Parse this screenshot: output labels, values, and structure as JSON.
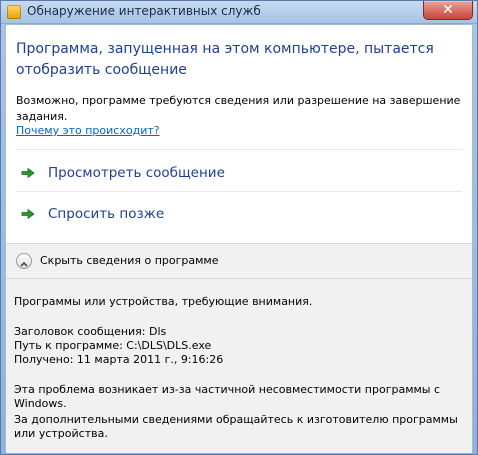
{
  "window": {
    "title": "Обнаружение интерактивных служб",
    "close_glyph": "✕"
  },
  "main": {
    "heading": "Программа, запущенная на этом компьютере, пытается отобразить сообщение",
    "description": "Возможно, программе требуются сведения или разрешение на завершение задания.",
    "why_link": "Почему это происходит?",
    "commands": [
      {
        "label": "Просмотреть сообщение",
        "icon": "green-arrow-icon"
      },
      {
        "label": "Спросить позже",
        "icon": "green-arrow-icon"
      }
    ]
  },
  "details_toggle": {
    "label": "Скрыть сведения о программе",
    "icon": "chevron-up-icon"
  },
  "details": {
    "intro": "Программы или устройства, требующие внимания.",
    "message_title": "Заголовок сообщения:  Dls",
    "program_path": "Путь к программе:  C:\\DLS\\DLS.exe",
    "received": "Получено:  11 марта 2011 г., 9:16:26",
    "problem_text": "Эта проблема возникает из-за частичной несовместимости программы с Windows.",
    "contact_text": "За дополнительными сведениями обращайтесь к изготовителю программы или устройства."
  },
  "colors": {
    "heading": "#1f3f95",
    "link": "#0066cc",
    "arrow": "#2a9a2a",
    "details_bg": "#f1f1f1"
  }
}
